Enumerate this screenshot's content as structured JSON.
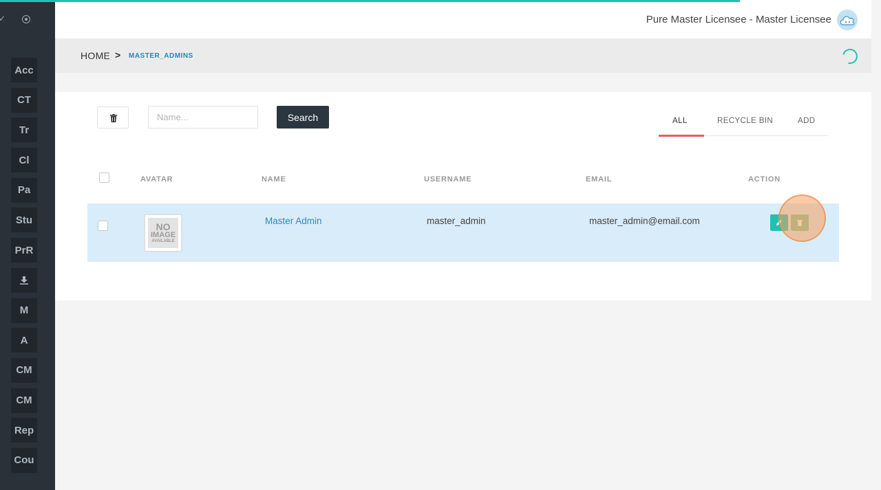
{
  "progress": {
    "fraction": 0.84
  },
  "sidebar": {
    "items": [
      {
        "label": "Acc"
      },
      {
        "label": "CT"
      },
      {
        "label": "Tr"
      },
      {
        "label": "Cl"
      },
      {
        "label": "Pa"
      },
      {
        "label": "Stu"
      },
      {
        "label": "PrR"
      },
      {
        "label": "",
        "icon": "download-icon"
      },
      {
        "label": "M"
      },
      {
        "label": "A"
      },
      {
        "label": "CM"
      },
      {
        "label": "CM"
      },
      {
        "label": "Rep"
      },
      {
        "label": "Cou"
      }
    ]
  },
  "header": {
    "user_label": "Pure Master Licensee - Master Licensee",
    "avatar_icon": "cloud-avatar-icon"
  },
  "breadcrumb": {
    "home": "HOME",
    "separator": ">",
    "current": "MASTER_ADMINS"
  },
  "toolbar": {
    "search_placeholder": "Name...",
    "search_button": "Search"
  },
  "tabs": [
    {
      "label": "ALL",
      "active": true
    },
    {
      "label": "RECYCLE BIN",
      "active": false
    },
    {
      "label": "ADD",
      "active": false
    }
  ],
  "table": {
    "columns": [
      "AVATAR",
      "NAME",
      "USERNAME",
      "EMAIL",
      "ACTION"
    ],
    "rows": [
      {
        "avatar": {
          "line1": "NO",
          "line2": "IMAGE",
          "line3": "AVAILABLE"
        },
        "name": "Master Admin",
        "username": "master_admin",
        "email": "master_admin@email.com"
      }
    ]
  },
  "colors": {
    "accent": "#1fc1b2",
    "sidebar": "#2a3139",
    "active_tab": "#e2615a",
    "row_highlight": "#d9ecf9",
    "link": "#2b8ac0"
  }
}
